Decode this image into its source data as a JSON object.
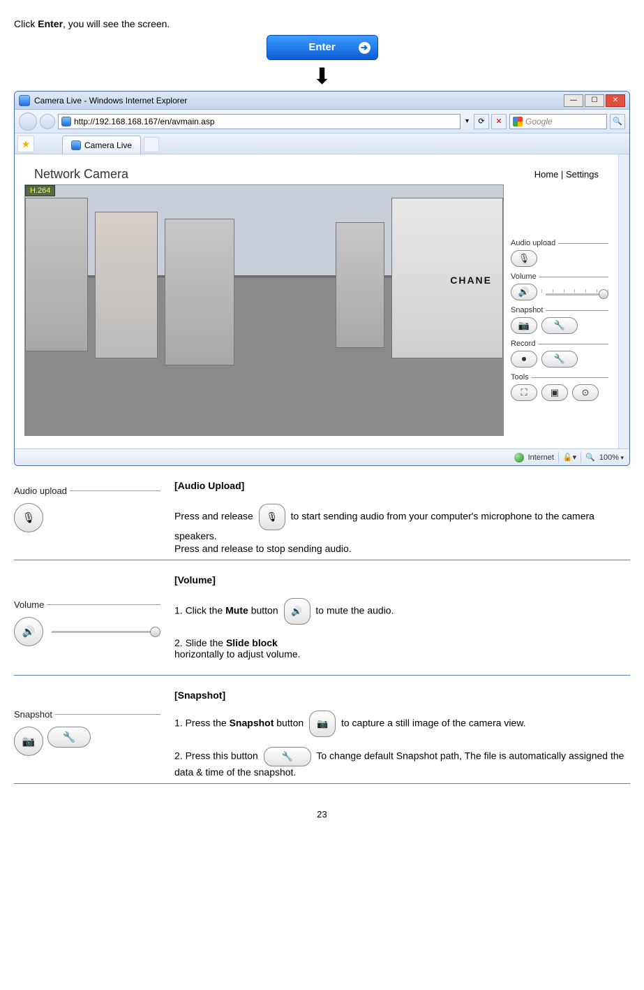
{
  "intro": {
    "click": "Click ",
    "enter_bold": "Enter",
    "tail": ", you will see the screen.",
    "enter_btn": "Enter"
  },
  "browser": {
    "title": "Camera Live - Windows Internet Explorer",
    "url": "http://192.168.168.167/en/avmain.asp",
    "search_placeholder": "Google",
    "tab": "Camera Live",
    "zoom": "100%",
    "status_zone": "Internet"
  },
  "page": {
    "title": "Network Camera",
    "nav_home": "Home",
    "nav_sep": " | ",
    "nav_settings": "Settings",
    "codec": "H.264",
    "brand": "CHANE"
  },
  "controls": {
    "audio_upload": "Audio upload",
    "volume": "Volume",
    "snapshot": "Snapshot",
    "record": "Record",
    "tools": "Tools"
  },
  "sections": {
    "audio": {
      "title": "[Audio Upload]",
      "label": "Audio upload",
      "p1a": "Press and release ",
      "p1b": " to start sending audio from your computer's microphone to the camera speakers.",
      "p2": "Press and release to stop sending audio."
    },
    "volume": {
      "title": "[Volume]",
      "label": "Volume",
      "l1a": "1. Click the ",
      "l1b": "Mute",
      "l1c": " button ",
      "l1d": " to mute the audio.",
      "l2a": "2. Slide the ",
      "l2b": "Slide block",
      "l2c": " ",
      "l2d": " horizontally to adjust volume."
    },
    "snapshot": {
      "title": "[Snapshot]",
      "label": "Snapshot",
      "l1a": "1. Press the ",
      "l1b": "Snapshot",
      "l1c": " button ",
      "l1d": " to capture a still image of the camera view.",
      "l2a": "2. Press this button ",
      "l2b": " To change default Snapshot path, The file is automatically assigned the data & time of the snapshot."
    }
  },
  "page_number": "23"
}
